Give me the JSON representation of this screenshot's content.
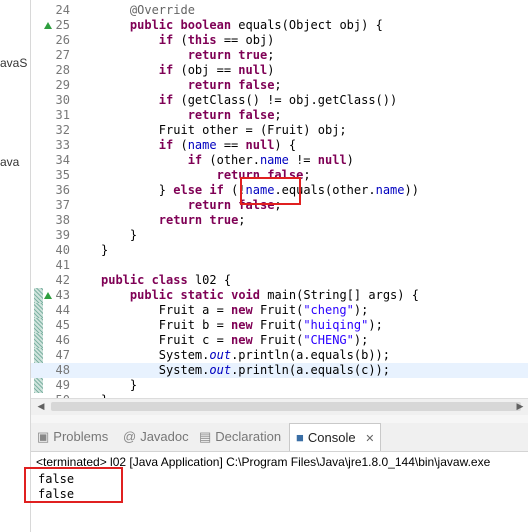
{
  "left_panel": {
    "fragments": [
      "avaS",
      "ava"
    ]
  },
  "editor": {
    "lines": [
      {
        "n": "24",
        "tokens": [
          {
            "t": "    "
          },
          {
            "t": "@Override",
            "c": "ann"
          }
        ]
      },
      {
        "n": "25",
        "tokens": [
          {
            "t": "    "
          },
          {
            "t": "public",
            "c": "kw"
          },
          {
            "t": " "
          },
          {
            "t": "boolean",
            "c": "kw"
          },
          {
            "t": " equals(Object obj) {"
          }
        ]
      },
      {
        "n": "26",
        "tokens": [
          {
            "t": "        "
          },
          {
            "t": "if",
            "c": "kw"
          },
          {
            "t": " ("
          },
          {
            "t": "this",
            "c": "kw"
          },
          {
            "t": " == obj)"
          }
        ]
      },
      {
        "n": "27",
        "tokens": [
          {
            "t": "            "
          },
          {
            "t": "return",
            "c": "kw"
          },
          {
            "t": " "
          },
          {
            "t": "true",
            "c": "kw"
          },
          {
            "t": ";"
          }
        ]
      },
      {
        "n": "28",
        "tokens": [
          {
            "t": "        "
          },
          {
            "t": "if",
            "c": "kw"
          },
          {
            "t": " (obj == "
          },
          {
            "t": "null",
            "c": "kw"
          },
          {
            "t": ")"
          }
        ]
      },
      {
        "n": "29",
        "tokens": [
          {
            "t": "            "
          },
          {
            "t": "return",
            "c": "kw"
          },
          {
            "t": " "
          },
          {
            "t": "false",
            "c": "kw"
          },
          {
            "t": ";"
          }
        ]
      },
      {
        "n": "30",
        "tokens": [
          {
            "t": "        "
          },
          {
            "t": "if",
            "c": "kw"
          },
          {
            "t": " (getClass() != obj.getClass())"
          }
        ]
      },
      {
        "n": "31",
        "tokens": [
          {
            "t": "            "
          },
          {
            "t": "return",
            "c": "kw"
          },
          {
            "t": " "
          },
          {
            "t": "false",
            "c": "kw"
          },
          {
            "t": ";"
          }
        ]
      },
      {
        "n": "32",
        "tokens": [
          {
            "t": "        Fruit other = (Fruit) obj;"
          }
        ]
      },
      {
        "n": "33",
        "tokens": [
          {
            "t": "        "
          },
          {
            "t": "if",
            "c": "kw"
          },
          {
            "t": " ("
          },
          {
            "t": "name",
            "c": "fld"
          },
          {
            "t": " == "
          },
          {
            "t": "null",
            "c": "kw"
          },
          {
            "t": ") {"
          }
        ]
      },
      {
        "n": "34",
        "tokens": [
          {
            "t": "            "
          },
          {
            "t": "if",
            "c": "kw"
          },
          {
            "t": " (other."
          },
          {
            "t": "name",
            "c": "fld"
          },
          {
            "t": " != "
          },
          {
            "t": "null",
            "c": "kw"
          },
          {
            "t": ")"
          }
        ]
      },
      {
        "n": "35",
        "tokens": [
          {
            "t": "                "
          },
          {
            "t": "return",
            "c": "kw"
          },
          {
            "t": " "
          },
          {
            "t": "false",
            "c": "kw"
          },
          {
            "t": ";"
          }
        ]
      },
      {
        "n": "36",
        "tokens": [
          {
            "t": "        } "
          },
          {
            "t": "else",
            "c": "kw"
          },
          {
            "t": " "
          },
          {
            "t": "if",
            "c": "kw"
          },
          {
            "t": " (!"
          },
          {
            "t": "name",
            "c": "fld"
          },
          {
            "t": ".equals(other."
          },
          {
            "t": "name",
            "c": "fld"
          },
          {
            "t": "))"
          }
        ]
      },
      {
        "n": "37",
        "tokens": [
          {
            "t": "            "
          },
          {
            "t": "return",
            "c": "kw"
          },
          {
            "t": " "
          },
          {
            "t": "false",
            "c": "kw"
          },
          {
            "t": ";"
          }
        ]
      },
      {
        "n": "38",
        "tokens": [
          {
            "t": "        "
          },
          {
            "t": "return",
            "c": "kw"
          },
          {
            "t": " "
          },
          {
            "t": "true",
            "c": "kw"
          },
          {
            "t": ";"
          }
        ]
      },
      {
        "n": "39",
        "tokens": [
          {
            "t": "    }"
          }
        ]
      },
      {
        "n": "40",
        "tokens": [
          {
            "t": "}"
          }
        ]
      },
      {
        "n": "41",
        "tokens": []
      },
      {
        "n": "42",
        "tokens": [
          {
            "t": "public",
            "c": "kw"
          },
          {
            "t": " "
          },
          {
            "t": "class",
            "c": "kw"
          },
          {
            "t": " l02 {"
          }
        ]
      },
      {
        "n": "43",
        "tokens": [
          {
            "t": "    "
          },
          {
            "t": "public",
            "c": "kw"
          },
          {
            "t": " "
          },
          {
            "t": "static",
            "c": "kw"
          },
          {
            "t": " "
          },
          {
            "t": "void",
            "c": "kw"
          },
          {
            "t": " main(String[] args) {"
          }
        ]
      },
      {
        "n": "44",
        "tokens": [
          {
            "t": "        Fruit a = "
          },
          {
            "t": "new",
            "c": "kw"
          },
          {
            "t": " Fruit("
          },
          {
            "t": "\"cheng\"",
            "c": "str"
          },
          {
            "t": ");"
          }
        ]
      },
      {
        "n": "45",
        "tokens": [
          {
            "t": "        Fruit b = "
          },
          {
            "t": "new",
            "c": "kw"
          },
          {
            "t": " Fruit("
          },
          {
            "t": "\"huiqing\"",
            "c": "str"
          },
          {
            "t": ");"
          }
        ]
      },
      {
        "n": "46",
        "tokens": [
          {
            "t": "        Fruit c = "
          },
          {
            "t": "new",
            "c": "kw"
          },
          {
            "t": " Fruit("
          },
          {
            "t": "\"CHENG\"",
            "c": "str"
          },
          {
            "t": ");"
          }
        ]
      },
      {
        "n": "47",
        "tokens": [
          {
            "t": "        System."
          },
          {
            "t": "out",
            "c": "sfld"
          },
          {
            "t": ".println(a.equals(b));"
          }
        ]
      },
      {
        "n": "48",
        "tokens": [
          {
            "t": "        System."
          },
          {
            "t": "out",
            "c": "sfld"
          },
          {
            "t": ".println(a.equals(c));"
          }
        ]
      },
      {
        "n": "49",
        "tokens": [
          {
            "t": "    }"
          }
        ]
      },
      {
        "n": "50",
        "tokens": [
          {
            "t": "}"
          }
        ]
      }
    ]
  },
  "tabs": [
    {
      "label": "Problems",
      "icon": "problems-icon",
      "glyph": "▣"
    },
    {
      "label": "Javadoc",
      "icon": "javadoc-icon",
      "glyph": "@"
    },
    {
      "label": "Declaration",
      "icon": "declaration-icon",
      "glyph": "▤"
    },
    {
      "label": "Console",
      "icon": "console-icon",
      "glyph": "■"
    }
  ],
  "tab_close": "✕",
  "console": {
    "terminated": "<terminated> l02 [Java Application] C:\\Program Files\\Java\\jre1.8.0_144\\bin\\javaw.exe",
    "output": [
      "false",
      "false"
    ]
  },
  "annotation_color": "#e02020"
}
